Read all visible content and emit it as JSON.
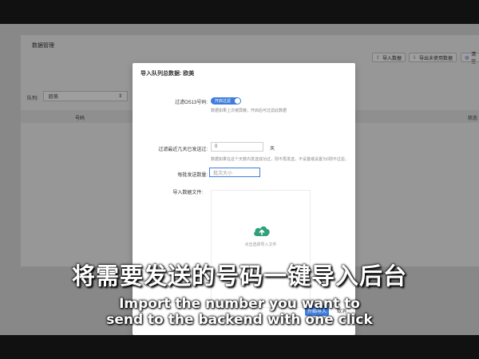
{
  "page": {
    "title": "数据管理",
    "buttons": [
      {
        "label": "导入数据",
        "icon": "import-icon"
      },
      {
        "label": "导出未使用数据",
        "icon": "export-icon"
      },
      {
        "label": "清空",
        "icon": "clear-icon"
      }
    ],
    "filter": {
      "label": "队列:",
      "value": "欧美",
      "second_value": "所有"
    },
    "table": {
      "columns": [
        "号码",
        "状态"
      ]
    }
  },
  "dialog": {
    "title": "导入队列总数据: 欧美",
    "filter_os13": {
      "label": "过滤OS13号码:",
      "toggle_text": "开启过滤",
      "toggle_on": true,
      "hint": "数据如果上次被屏蔽，开启后可过滤此数据"
    },
    "filter_recent": {
      "label": "过滤最近几天已发送过:",
      "value": "0",
      "unit": "天",
      "hint": "数据如果在这个天数内发送成功过，则不再发送，不设置或设置为0则不过滤。"
    },
    "batch_size": {
      "label": "每批发送数量:",
      "placeholder": "批次大小"
    },
    "import_file": {
      "label": "导入数据文件:",
      "upload_text": "点击选择导入文件"
    },
    "buttons": {
      "confirm": "开始导入",
      "cancel": "取消"
    }
  },
  "subtitle": {
    "cn": "将需要发送的号码一键导入后台",
    "en_line1": "Import the number you want to",
    "en_line2": "send to the backend with one click"
  },
  "colors": {
    "accent": "#3f7ddc",
    "upload_icon": "#2fa07b"
  }
}
